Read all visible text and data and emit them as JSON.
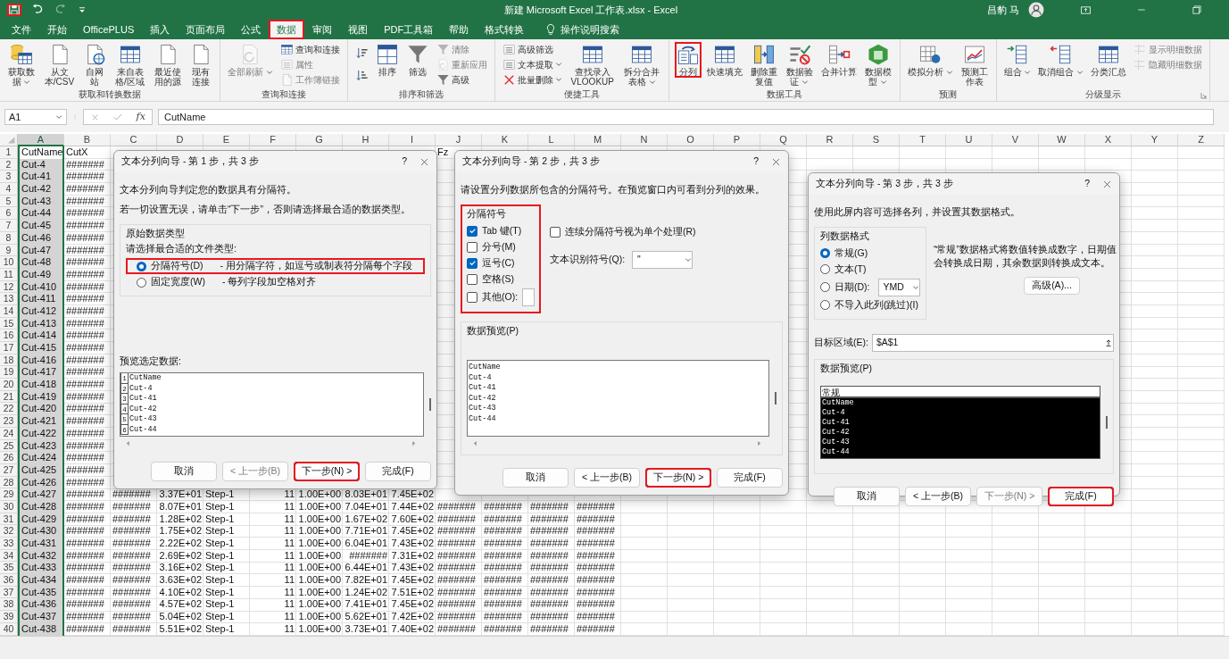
{
  "window": {
    "title": "新建 Microsoft Excel 工作表.xlsx - Excel",
    "user": "昌豹 马"
  },
  "quick_access": [
    {
      "kind": "save",
      "highlighted": true,
      "disabled": false
    },
    {
      "kind": "undo",
      "highlighted": false,
      "disabled": false
    },
    {
      "kind": "redo",
      "highlighted": false,
      "disabled": true
    },
    {
      "kind": "customize",
      "highlighted": false,
      "disabled": false
    }
  ],
  "tabs": [
    {
      "label": "文件",
      "selected": false,
      "highlighted": false
    },
    {
      "label": "开始",
      "selected": false,
      "highlighted": false
    },
    {
      "label": "OfficePLUS",
      "selected": false,
      "highlighted": false
    },
    {
      "label": "插入",
      "selected": false,
      "highlighted": false
    },
    {
      "label": "页面布局",
      "selected": false,
      "highlighted": false
    },
    {
      "label": "公式",
      "selected": false,
      "highlighted": false
    },
    {
      "label": "数据",
      "selected": true,
      "highlighted": true
    },
    {
      "label": "审阅",
      "selected": false,
      "highlighted": false
    },
    {
      "label": "视图",
      "selected": false,
      "highlighted": false
    },
    {
      "label": "PDF工具箱",
      "selected": false,
      "highlighted": false
    },
    {
      "label": "帮助",
      "selected": false,
      "highlighted": false
    },
    {
      "label": "格式转换",
      "selected": false,
      "highlighted": false
    }
  ],
  "tell_me": "操作说明搜索",
  "ribbon": [
    {
      "label": "获取和转换数据",
      "launcher": false,
      "items": [
        {
          "kind": "large",
          "label": "获取数据",
          "menu": true,
          "disabled": false,
          "highlighted": false
        },
        {
          "kind": "large",
          "label": "从文本/CSV",
          "menu": false,
          "disabled": false,
          "highlighted": false
        },
        {
          "kind": "large",
          "label": "自网站",
          "menu": false,
          "disabled": false,
          "highlighted": false
        },
        {
          "kind": "large",
          "label": "来自表格/区域",
          "menu": false,
          "disabled": false,
          "highlighted": false
        },
        {
          "kind": "large",
          "label": "最近使用的源",
          "menu": false,
          "disabled": false,
          "highlighted": false
        },
        {
          "kind": "large",
          "label": "现有连接",
          "menu": false,
          "disabled": false,
          "highlighted": false
        }
      ]
    },
    {
      "label": "查询和连接",
      "launcher": false,
      "items": [
        {
          "kind": "large",
          "label": "全部刷新",
          "menu": true,
          "disabled": true,
          "highlighted": false
        },
        {
          "kind": "small",
          "label": "查询和连接",
          "menu": false,
          "disabled": false,
          "highlighted": false
        },
        {
          "kind": "small",
          "label": "属性",
          "menu": false,
          "disabled": true,
          "highlighted": false
        },
        {
          "kind": "small",
          "label": "工作簿链接",
          "menu": false,
          "disabled": true,
          "highlighted": false
        }
      ]
    },
    {
      "label": "排序和筛选",
      "launcher": false,
      "items": [
        {
          "kind": "icon",
          "menu": false,
          "disabled": false,
          "highlighted": false
        },
        {
          "kind": "icon",
          "menu": false,
          "disabled": false,
          "highlighted": false
        },
        {
          "kind": "large",
          "label": "排序",
          "menu": false,
          "disabled": false,
          "highlighted": false
        },
        {
          "kind": "large",
          "label": "筛选",
          "menu": false,
          "disabled": false,
          "highlighted": false
        },
        {
          "kind": "small",
          "label": "清除",
          "menu": false,
          "disabled": true,
          "highlighted": false
        },
        {
          "kind": "small",
          "label": "重新应用",
          "menu": false,
          "disabled": true,
          "highlighted": false
        },
        {
          "kind": "small",
          "label": "高级",
          "menu": false,
          "disabled": false,
          "highlighted": false
        }
      ]
    },
    {
      "label": "便捷工具",
      "launcher": false,
      "items": [
        {
          "kind": "small",
          "label": "高级筛选",
          "menu": false,
          "disabled": false,
          "highlighted": false
        },
        {
          "kind": "small",
          "label": "文本提取",
          "menu": true,
          "disabled": false,
          "highlighted": false
        },
        {
          "kind": "small",
          "label": "批量删除",
          "menu": true,
          "disabled": false,
          "highlighted": false
        },
        {
          "kind": "large",
          "label": "查找录入VLOOKUP",
          "menu": false,
          "disabled": false,
          "highlighted": false
        },
        {
          "kind": "large",
          "label": "拆分合并表格",
          "menu": true,
          "disabled": false,
          "highlighted": false
        }
      ]
    },
    {
      "label": "数据工具",
      "launcher": false,
      "items": [
        {
          "kind": "large",
          "label": "分列",
          "menu": false,
          "disabled": false,
          "highlighted": true
        },
        {
          "kind": "large",
          "label": "快速填充",
          "menu": false,
          "disabled": false,
          "highlighted": false
        },
        {
          "kind": "large",
          "label": "删除重复值",
          "menu": false,
          "disabled": false,
          "highlighted": false
        },
        {
          "kind": "large",
          "label": "数据验证",
          "menu": true,
          "disabled": false,
          "highlighted": false
        },
        {
          "kind": "large",
          "label": "合并计算",
          "menu": false,
          "disabled": false,
          "highlighted": false
        },
        {
          "kind": "large",
          "label": "数据模型",
          "menu": true,
          "disabled": false,
          "highlighted": false
        }
      ]
    },
    {
      "label": "预测",
      "launcher": false,
      "items": [
        {
          "kind": "large",
          "label": "模拟分析",
          "menu": true,
          "disabled": false,
          "highlighted": false
        },
        {
          "kind": "large",
          "label": "预测工作表",
          "menu": false,
          "disabled": false,
          "highlighted": false
        }
      ]
    },
    {
      "label": "分级显示",
      "launcher": true,
      "items": [
        {
          "kind": "large",
          "label": "组合",
          "menu": true,
          "disabled": false,
          "highlighted": false
        },
        {
          "kind": "large",
          "label": "取消组合",
          "menu": true,
          "disabled": false,
          "highlighted": false
        },
        {
          "kind": "large",
          "label": "分类汇总",
          "menu": false,
          "disabled": false,
          "highlighted": false
        },
        {
          "kind": "small",
          "label": "显示明细数据",
          "menu": false,
          "disabled": true,
          "highlighted": false
        },
        {
          "kind": "small",
          "label": "隐藏明细数据",
          "menu": false,
          "disabled": true,
          "highlighted": false
        }
      ]
    }
  ],
  "formula_bar": {
    "name_box": "A1",
    "function_label": "fx",
    "value": "CutName"
  },
  "sheet": {
    "columns": [
      {
        "label": "A",
        "selected": true
      },
      {
        "label": "B",
        "selected": false
      },
      {
        "label": "C",
        "selected": false
      },
      {
        "label": "D",
        "selected": false
      },
      {
        "label": "E",
        "selected": false
      },
      {
        "label": "F",
        "selected": false
      },
      {
        "label": "G",
        "selected": false
      },
      {
        "label": "H",
        "selected": false
      },
      {
        "label": "I",
        "selected": false
      },
      {
        "label": "J",
        "selected": false
      },
      {
        "label": "K",
        "selected": false
      },
      {
        "label": "L",
        "selected": false
      },
      {
        "label": "M",
        "selected": false
      },
      {
        "label": "N",
        "selected": false
      },
      {
        "label": "O",
        "selected": false
      },
      {
        "label": "P",
        "selected": false
      },
      {
        "label": "Q",
        "selected": false
      },
      {
        "label": "R",
        "selected": false
      },
      {
        "label": "S",
        "selected": false
      },
      {
        "label": "T",
        "selected": false
      },
      {
        "label": "U",
        "selected": false
      },
      {
        "label": "V",
        "selected": false
      },
      {
        "label": "W",
        "selected": false
      },
      {
        "label": "X",
        "selected": false
      },
      {
        "label": "Y",
        "selected": false
      },
      {
        "label": "Z",
        "selected": false
      }
    ],
    "rows": [
      {
        "label": "1",
        "cells": [
          "CutName",
          "CutX",
          null,
          null,
          null,
          null,
          null,
          null,
          null,
          "Fz"
        ]
      },
      {
        "label": "2",
        "cells": [
          "Cut-4",
          "#######"
        ]
      },
      {
        "label": "3",
        "cells": [
          "Cut-41",
          "#######"
        ]
      },
      {
        "label": "4",
        "cells": [
          "Cut-42",
          "#######"
        ]
      },
      {
        "label": "5",
        "cells": [
          "Cut-43",
          "#######"
        ]
      },
      {
        "label": "6",
        "cells": [
          "Cut-44",
          "#######"
        ]
      },
      {
        "label": "7",
        "cells": [
          "Cut-45",
          "#######"
        ]
      },
      {
        "label": "8",
        "cells": [
          "Cut-46",
          "#######"
        ]
      },
      {
        "label": "9",
        "cells": [
          "Cut-47",
          "#######"
        ]
      },
      {
        "label": "10",
        "cells": [
          "Cut-48",
          "#######"
        ]
      },
      {
        "label": "11",
        "cells": [
          "Cut-49",
          "#######"
        ]
      },
      {
        "label": "12",
        "cells": [
          "Cut-410",
          "#######"
        ]
      },
      {
        "label": "13",
        "cells": [
          "Cut-411",
          "#######"
        ]
      },
      {
        "label": "14",
        "cells": [
          "Cut-412",
          "#######"
        ]
      },
      {
        "label": "15",
        "cells": [
          "Cut-413",
          "#######"
        ]
      },
      {
        "label": "16",
        "cells": [
          "Cut-414",
          "#######"
        ]
      },
      {
        "label": "17",
        "cells": [
          "Cut-415",
          "#######"
        ]
      },
      {
        "label": "18",
        "cells": [
          "Cut-416",
          "#######"
        ]
      },
      {
        "label": "19",
        "cells": [
          "Cut-417",
          "#######"
        ]
      },
      {
        "label": "20",
        "cells": [
          "Cut-418",
          "#######"
        ]
      },
      {
        "label": "21",
        "cells": [
          "Cut-419",
          "#######"
        ]
      },
      {
        "label": "22",
        "cells": [
          "Cut-420",
          "#######"
        ]
      },
      {
        "label": "23",
        "cells": [
          "Cut-421",
          "#######"
        ]
      },
      {
        "label": "24",
        "cells": [
          "Cut-422",
          "#######"
        ]
      },
      {
        "label": "25",
        "cells": [
          "Cut-423",
          "#######"
        ]
      },
      {
        "label": "26",
        "cells": [
          "Cut-424",
          "#######"
        ]
      },
      {
        "label": "27",
        "cells": [
          "Cut-425",
          "#######"
        ]
      },
      {
        "label": "28",
        "cells": [
          "Cut-426",
          "#######"
        ]
      },
      {
        "label": "29",
        "cells": [
          "Cut-427",
          "#######",
          "#######",
          "3.37E+01",
          "Step-1",
          "11",
          "1.00E+00",
          "8.03E+01",
          "7.45E+02"
        ]
      },
      {
        "label": "30",
        "cells": [
          "Cut-428",
          "#######",
          "#######",
          "8.07E+01",
          "Step-1",
          "11",
          "1.00E+00",
          "7.04E+01",
          "7.44E+02",
          "#######",
          "#######",
          "#######",
          "#######"
        ]
      },
      {
        "label": "31",
        "cells": [
          "Cut-429",
          "#######",
          "#######",
          "1.28E+02",
          "Step-1",
          "11",
          "1.00E+00",
          "1.67E+02",
          "7.60E+02",
          "#######",
          "#######",
          "#######",
          "#######"
        ]
      },
      {
        "label": "32",
        "cells": [
          "Cut-430",
          "#######",
          "#######",
          "1.75E+02",
          "Step-1",
          "11",
          "1.00E+00",
          "7.71E+01",
          "7.45E+02",
          "#######",
          "#######",
          "#######",
          "#######"
        ]
      },
      {
        "label": "33",
        "cells": [
          "Cut-431",
          "#######",
          "#######",
          "2.22E+02",
          "Step-1",
          "11",
          "1.00E+00",
          "6.04E+01",
          "7.43E+02",
          "#######",
          "#######",
          "#######",
          "#######"
        ]
      },
      {
        "label": "34",
        "cells": [
          "Cut-432",
          "#######",
          "#######",
          "2.69E+02",
          "Step-1",
          "11",
          "1.00E+00",
          "#######",
          "7.31E+02",
          "#######",
          "#######",
          "#######",
          "#######"
        ]
      },
      {
        "label": "35",
        "cells": [
          "Cut-433",
          "#######",
          "#######",
          "3.16E+02",
          "Step-1",
          "11",
          "1.00E+00",
          "6.44E+01",
          "7.43E+02",
          "#######",
          "#######",
          "#######",
          "#######"
        ]
      },
      {
        "label": "36",
        "cells": [
          "Cut-434",
          "#######",
          "#######",
          "3.63E+02",
          "Step-1",
          "11",
          "1.00E+00",
          "7.82E+01",
          "7.45E+02",
          "#######",
          "#######",
          "#######",
          "#######"
        ]
      },
      {
        "label": "37",
        "cells": [
          "Cut-435",
          "#######",
          "#######",
          "4.10E+02",
          "Step-1",
          "11",
          "1.00E+00",
          "1.24E+02",
          "7.51E+02",
          "#######",
          "#######",
          "#######",
          "#######"
        ]
      },
      {
        "label": "38",
        "cells": [
          "Cut-436",
          "#######",
          "#######",
          "4.57E+02",
          "Step-1",
          "11",
          "1.00E+00",
          "7.41E+01",
          "7.45E+02",
          "#######",
          "#######",
          "#######",
          "#######"
        ]
      },
      {
        "label": "39",
        "cells": [
          "Cut-437",
          "#######",
          "#######",
          "5.04E+02",
          "Step-1",
          "11",
          "1.00E+00",
          "5.62E+01",
          "7.42E+02",
          "#######",
          "#######",
          "#######",
          "#######"
        ]
      },
      {
        "label": "40",
        "cells": [
          "Cut-438",
          "#######",
          "#######",
          "5.51E+02",
          "Step-1",
          "11",
          "1.00E+00",
          "3.73E+01",
          "7.40E+02",
          "#######",
          "#######",
          "#######",
          "#######"
        ]
      }
    ]
  },
  "dialogs": [
    {
      "kind": "step1",
      "title": "文本分列向导 - 第 1 步，共 3 步",
      "help": "?",
      "intro": [
        "文本分列向导判定您的数据具有分隔符。",
        "若一切设置无误，请单击“下一步”，否则请选择最合适的数据类型。"
      ],
      "group": {
        "legend": "原始数据类型",
        "prompt": "请选择最合适的文件类型:",
        "options": [
          {
            "label": "分隔符号(D)",
            "description": "- 用分隔字符，如逗号或制表符分隔每个字段",
            "selected": true,
            "highlighted": true
          },
          {
            "label": "固定宽度(W)",
            "description": "- 每列字段加空格对齐",
            "selected": false,
            "highlighted": false
          }
        ]
      },
      "preview": {
        "label": "预览选定数据:",
        "line_numbers": [
          "1",
          "2",
          "3",
          "4",
          "5",
          "6"
        ],
        "lines": [
          "CutName",
          "Cut-4",
          "Cut-41",
          "Cut-42",
          "Cut-43",
          "Cut-44"
        ]
      },
      "buttons": [
        {
          "label": "取消",
          "disabled": false,
          "default": false,
          "highlighted": false
        },
        {
          "label": "< 上一步(B)",
          "disabled": true,
          "default": false,
          "highlighted": false
        },
        {
          "label": "下一步(N) >",
          "disabled": false,
          "default": true,
          "highlighted": true
        },
        {
          "label": "完成(F)",
          "disabled": false,
          "default": false,
          "highlighted": false
        }
      ]
    },
    {
      "kind": "step2",
      "title": "文本分列向导 - 第 2 步，共 3 步",
      "help": "?",
      "intro": [
        "请设置分列数据所包含的分隔符号。在预览窗口内可看到分列的效果。"
      ],
      "delimiters": {
        "legend": "分隔符号",
        "highlighted": true,
        "options": [
          {
            "kind": "plain",
            "label": "Tab 键(T)",
            "checked": true
          },
          {
            "kind": "plain",
            "label": "分号(M)",
            "checked": false
          },
          {
            "kind": "plain",
            "label": "逗号(C)",
            "checked": true
          },
          {
            "kind": "plain",
            "label": "空格(S)",
            "checked": false
          },
          {
            "kind": "with_field",
            "label": "其他(O):",
            "checked": false
          }
        ]
      },
      "consecutive": {
        "label": "连续分隔符号视为单个处理(R)",
        "checked": false
      },
      "qualifier": {
        "label": "文本识别符号(Q):",
        "value": "\""
      },
      "preview": {
        "label": "数据预览(P)",
        "lines": [
          "CutName",
          "Cut-4",
          "Cut-41",
          "Cut-42",
          "Cut-43",
          "Cut-44"
        ]
      },
      "buttons": [
        {
          "label": "取消",
          "disabled": false,
          "default": false,
          "highlighted": false
        },
        {
          "label": "< 上一步(B)",
          "disabled": false,
          "default": false,
          "highlighted": false
        },
        {
          "label": "下一步(N) >",
          "disabled": false,
          "default": true,
          "highlighted": true
        },
        {
          "label": "完成(F)",
          "disabled": false,
          "default": false,
          "highlighted": false
        }
      ]
    },
    {
      "kind": "step3",
      "title": "文本分列向导 - 第 3 步，共 3 步",
      "help": "?",
      "intro": [
        "使用此屏内容可选择各列，并设置其数据格式。"
      ],
      "format": {
        "legend": "列数据格式",
        "options": [
          {
            "kind": "plain",
            "label": "常规(G)",
            "selected": true
          },
          {
            "kind": "plain",
            "label": "文本(T)",
            "selected": false
          },
          {
            "kind": "with_select",
            "label": "日期(D):",
            "selected": false,
            "value": "YMD"
          },
          {
            "kind": "plain",
            "label": "不导入此列(跳过)(I)",
            "selected": false
          }
        ]
      },
      "note": "“常规”数据格式将数值转换成数字，日期值会转换成日期，其余数据则转换成文本。",
      "advanced_button": "高级(A)...",
      "destination": {
        "label": "目标区域(E):",
        "value": "$A$1"
      },
      "preview": {
        "label": "数据预览(P)",
        "columns": [
          {
            "header": "常规",
            "selected": true
          }
        ],
        "lines": [
          "CutName",
          "Cut-4",
          "Cut-41",
          "Cut-42",
          "Cut-43",
          "Cut-44"
        ]
      },
      "buttons": [
        {
          "label": "取消",
          "disabled": false,
          "default": false,
          "highlighted": false
        },
        {
          "label": "< 上一步(B)",
          "disabled": false,
          "default": false,
          "highlighted": false
        },
        {
          "label": "下一步(N) >",
          "disabled": true,
          "default": false,
          "highlighted": false
        },
        {
          "label": "完成(F)",
          "disabled": false,
          "default": true,
          "highlighted": true
        }
      ]
    }
  ]
}
